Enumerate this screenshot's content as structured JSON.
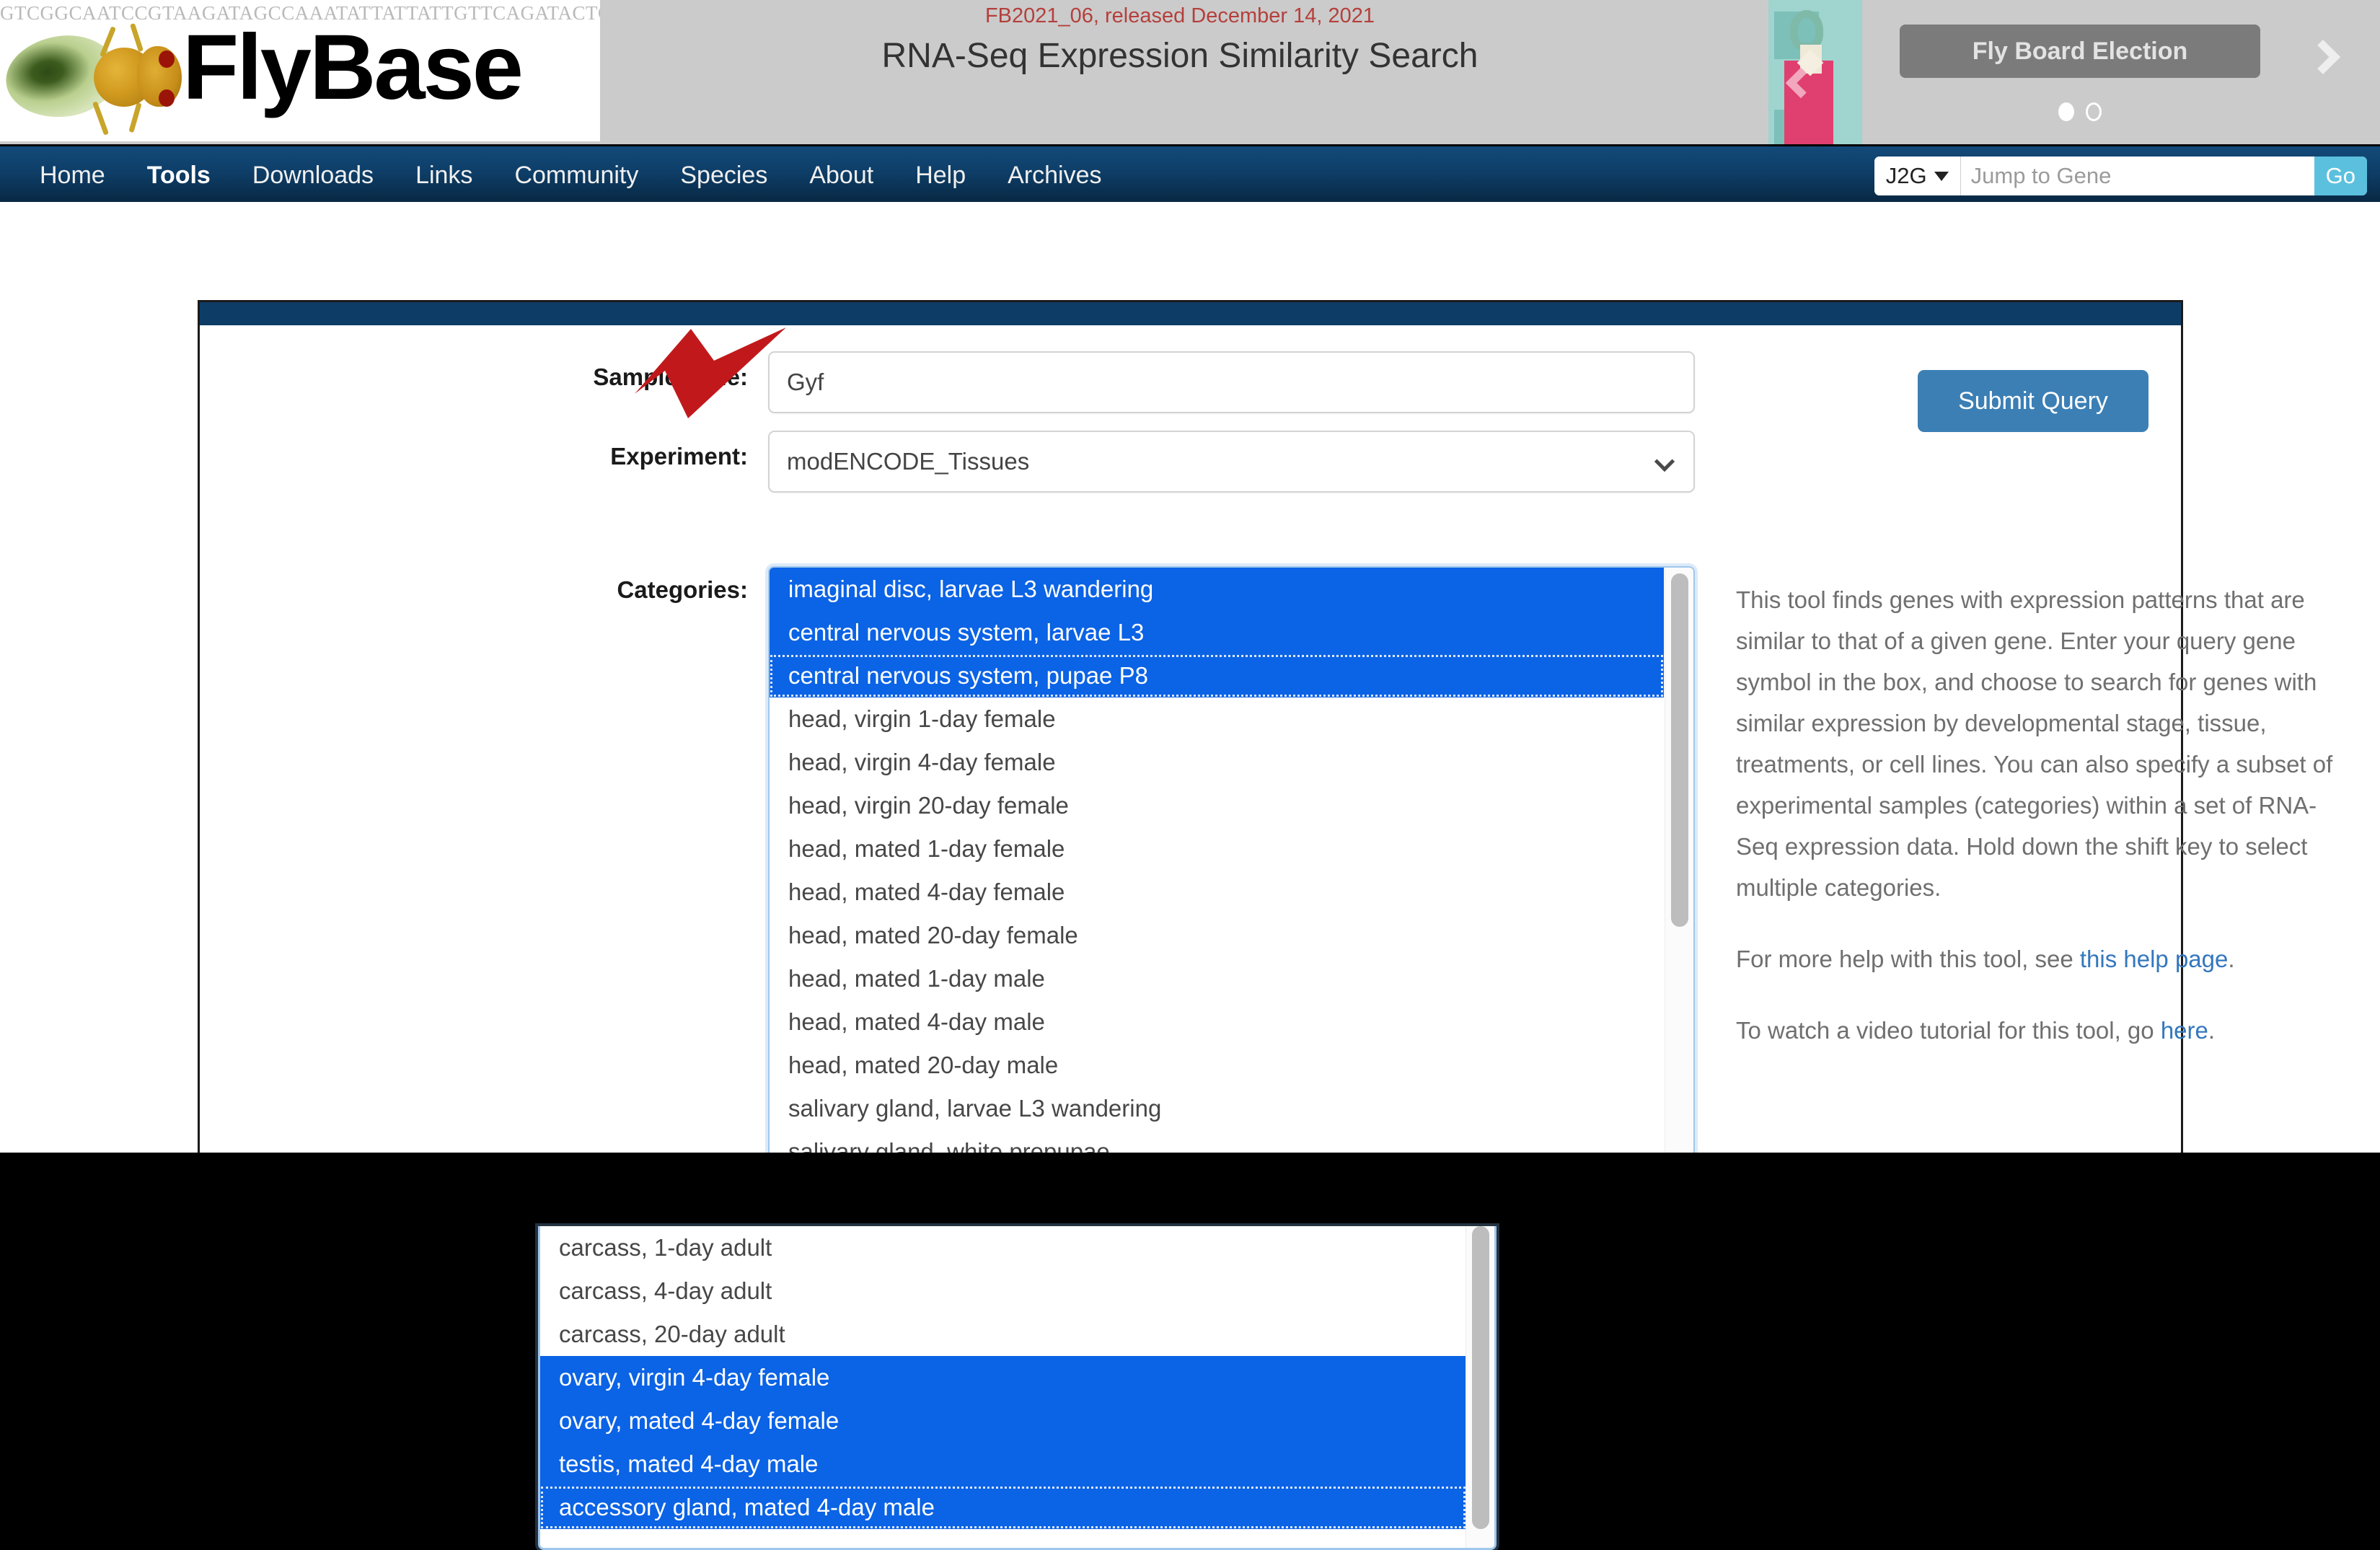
{
  "masthead": {
    "logo_text": "FlyBase",
    "dna_sequence": "GTCGGCAATCCGTAAGATAGCCAAATATTATTATTGTTCAGATACTCACGAGCCAGACAACTGCAGATCCGACTGGAGTGTTTTGAAATCAGTGAAATTCGACTATTAGTCTAGACAAATTCGTACAGCTGCAATTGCAATCCAGACAGTCATCAATCGATCGAGCTAGCAGGCTTCAATGCATTTCAGGTCAATAATCAGATTCAGCCGGCAAAGCGGACTTTTTGAGGAATGAATGAATTAAATGAACATTAATAATAAAAACAACAACAGTGCAACAACAGCCGGGGCATCTTCATAGATCAGGTCAATCCGTAAGATAGCCAAATATTATTATTGTTCAGATACTCAC",
    "release_note": "FB2021_06, released December 14, 2021",
    "tool_title": "RNA-Seq Expression Similarity Search"
  },
  "carousel": {
    "banner_label": "Fly Board Election",
    "prev_icon": "chevron-left-icon",
    "next_icon": "chevron-right-icon",
    "dots": [
      "active",
      "inactive"
    ]
  },
  "nav": {
    "items": [
      {
        "label": "Home",
        "active": false
      },
      {
        "label": "Tools",
        "active": true
      },
      {
        "label": "Downloads",
        "active": false
      },
      {
        "label": "Links",
        "active": false
      },
      {
        "label": "Community",
        "active": false
      },
      {
        "label": "Species",
        "active": false
      },
      {
        "label": "About",
        "active": false
      },
      {
        "label": "Help",
        "active": false
      },
      {
        "label": "Archives",
        "active": false
      }
    ],
    "search": {
      "mode_label": "J2G",
      "placeholder": "Jump to Gene",
      "value": "",
      "go_label": "Go"
    }
  },
  "form": {
    "sample_gene": {
      "label": "Sample gene:",
      "value": "Gyf",
      "placeholder": ""
    },
    "experiment": {
      "label": "Experiment:",
      "selected": "modENCODE_Tissues"
    },
    "categories": {
      "label": "Categories:",
      "options": [
        {
          "label": "imaginal disc, larvae L3 wandering",
          "selected": true,
          "focused": false
        },
        {
          "label": "central nervous system, larvae L3",
          "selected": true,
          "focused": false
        },
        {
          "label": "central nervous system, pupae P8",
          "selected": true,
          "focused": true
        },
        {
          "label": "head, virgin 1-day female",
          "selected": false,
          "focused": false
        },
        {
          "label": "head, virgin 4-day female",
          "selected": false,
          "focused": false
        },
        {
          "label": "head, virgin 20-day female",
          "selected": false,
          "focused": false
        },
        {
          "label": "head, mated 1-day female",
          "selected": false,
          "focused": false
        },
        {
          "label": "head, mated 4-day female",
          "selected": false,
          "focused": false
        },
        {
          "label": "head, mated 20-day female",
          "selected": false,
          "focused": false
        },
        {
          "label": "head, mated 1-day male",
          "selected": false,
          "focused": false
        },
        {
          "label": "head, mated 4-day male",
          "selected": false,
          "focused": false
        },
        {
          "label": "head, mated 20-day male",
          "selected": false,
          "focused": false
        },
        {
          "label": "salivary gland, larvae L3 wandering",
          "selected": false,
          "focused": false
        },
        {
          "label": "salivary gland, white prepupae",
          "selected": false,
          "focused": false
        }
      ],
      "options_lower": [
        {
          "label": "carcass, 1-day adult",
          "selected": false,
          "focused": false
        },
        {
          "label": "carcass, 4-day adult",
          "selected": false,
          "focused": false
        },
        {
          "label": "carcass, 20-day adult",
          "selected": false,
          "focused": false
        },
        {
          "label": "ovary, virgin 4-day female",
          "selected": true,
          "focused": false
        },
        {
          "label": "ovary, mated 4-day female",
          "selected": true,
          "focused": false
        },
        {
          "label": "testis, mated 4-day male",
          "selected": true,
          "focused": false
        },
        {
          "label": "accessory gland, mated 4-day male",
          "selected": true,
          "focused": true
        }
      ]
    },
    "submit_label": "Submit Query"
  },
  "help": {
    "paragraph": "This tool finds genes with expression patterns that are similar to that of a given gene. Enter your query gene symbol in the box, and choose to search for genes with similar expression by developmental stage, tissue, treatments, or cell lines. You can also specify a subset of experimental samples (categories) within a set of RNA-Seq expression data. Hold down the shift key to select multiple categories.",
    "help_line_prefix": "For more help with this tool, see ",
    "help_link": "this help page",
    "help_line_suffix": ".",
    "video_line_prefix": "To watch a video tutorial for this tool, go ",
    "video_link": "here",
    "video_line_suffix": "."
  },
  "annotation": {
    "arrow_color": "#c1191b",
    "points_at": "sample-gene-input"
  },
  "colors": {
    "navy_nav": "#0e3e68",
    "panel_strip": "#0d3c66",
    "selection_blue": "#0b63e5",
    "submit_blue": "#3b7fb5",
    "go_blue": "#5bc0de",
    "release_red": "#b4403c",
    "link_blue": "#3477bd"
  }
}
